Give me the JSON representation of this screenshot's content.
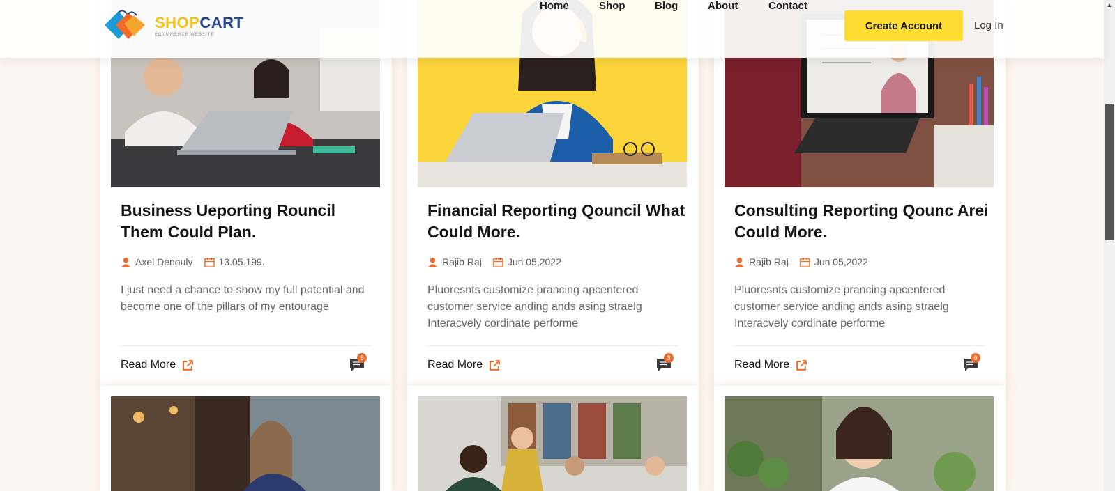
{
  "header": {
    "logo": {
      "word_shop": "SHOP",
      "word_cart": "CART",
      "tagline": "ECOMMERCE WEBSITE"
    },
    "nav": [
      "Home",
      "Shop",
      "Blog",
      "About",
      "Contact"
    ],
    "create_account": "Create Account",
    "login": "Log In"
  },
  "colors": {
    "accent_yellow": "#ffdd33",
    "accent_orange": "#f26a28",
    "logo_blue": "#24488f",
    "page_bg": "#fdf6f0"
  },
  "posts": [
    {
      "title": "Business Ueporting Rouncil Them Could Plan.",
      "author": "Axel Denouly",
      "date": "13.05.199..",
      "excerpt": "I just need a chance to show my full potential and become one of the pillars of my entourage",
      "read_more": "Read More",
      "comments": "5",
      "image": "students-laptop-photo"
    },
    {
      "title": "Financial Reporting Qouncil What Could More.",
      "author": "Rajib Raj",
      "date": "Jun 05,2022",
      "excerpt": "Pluoresnts customize prancing apcentered customer service anding ands asing straelg Interacvely cordinate performe",
      "read_more": "Read More",
      "comments": "3",
      "image": "girl-headphones-laptop-photo"
    },
    {
      "title": "Consulting Reporting Qounc Arei Could More.",
      "author": "Rajib Raj",
      "date": "Jun 05,2022",
      "excerpt": "Pluoresnts customize prancing apcentered customer service anding ands asing straelg Interacvely cordinate performe",
      "read_more": "Read More",
      "comments": "0",
      "image": "online-class-photo"
    },
    {
      "image": "woman-cafe-laptop-photo"
    },
    {
      "image": "students-library-photo"
    },
    {
      "image": "smiling-woman-plants-photo"
    }
  ],
  "icons": {
    "author": "user-icon",
    "date": "calendar-icon",
    "read_more": "external-link-icon",
    "comments": "comment-icon"
  }
}
